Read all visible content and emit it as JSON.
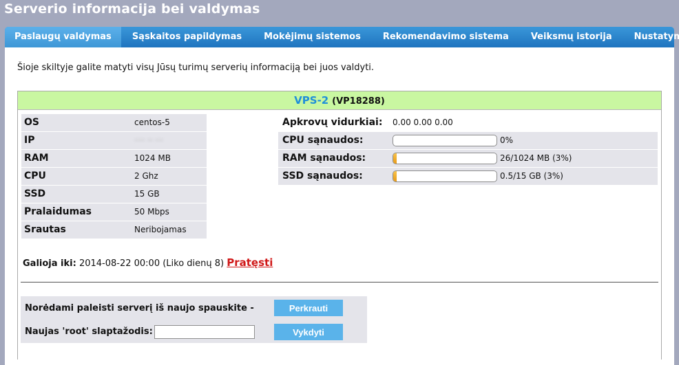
{
  "page": {
    "title": "Serverio informacija bei valdymas"
  },
  "tabs": [
    {
      "label": "Paslaugų valdymas",
      "active": true
    },
    {
      "label": "Sąskaitos papildymas"
    },
    {
      "label": "Mokėjimų sistemos"
    },
    {
      "label": "Rekomendavimo sistema"
    },
    {
      "label": "Veiksmų istorija"
    },
    {
      "label": "Nustatymai"
    }
  ],
  "intro": "Šioje skiltyje galite matyti visų Jūsų turimų serverių informaciją bei juos valdyti.",
  "server": {
    "name": "VPS-2",
    "code": "(VP18288)",
    "specs": [
      {
        "label": "OS",
        "value": "centos-5"
      },
      {
        "label": "IP",
        "value": "···· ·· ···"
      },
      {
        "label": "RAM",
        "value": "1024 MB"
      },
      {
        "label": "CPU",
        "value": "2 Ghz"
      },
      {
        "label": "SSD",
        "value": "15 GB"
      },
      {
        "label": "Pralaidumas",
        "value": "50 Mbps"
      },
      {
        "label": "Srautas",
        "value": "Neribojamas"
      }
    ],
    "load": {
      "label": "Apkrovų vidurkiai:",
      "value": "0.00 0.00 0.00"
    },
    "usage": [
      {
        "label": "CPU sąnaudos:",
        "percent": 0,
        "text": "0%"
      },
      {
        "label": "RAM sąnaudos:",
        "percent": 3,
        "text": "26/1024 MB (3%)"
      },
      {
        "label": "SSD sąnaudos:",
        "percent": 3,
        "text": "0.5/15 GB (3%)"
      }
    ],
    "expiry": {
      "label": "Galioja iki:",
      "value": "2014-08-22 00:00 (Liko dienų 8)",
      "renew_label": "Pratęsti"
    }
  },
  "actions": {
    "restart_label": "Norėdami paleisti serverį iš naujo spauskite -",
    "restart_button": "Perkrauti",
    "root_label": "Naujas 'root' slaptažodis:",
    "root_value": "",
    "root_button": "Vykdyti"
  },
  "colors": {
    "background": "#a3a8bd",
    "tab_bar": "#2a83cc",
    "panel_header": "#c9f7a1",
    "button": "#5ab3ea",
    "renew_link": "#d01818",
    "server_name": "#1f8fd9"
  }
}
